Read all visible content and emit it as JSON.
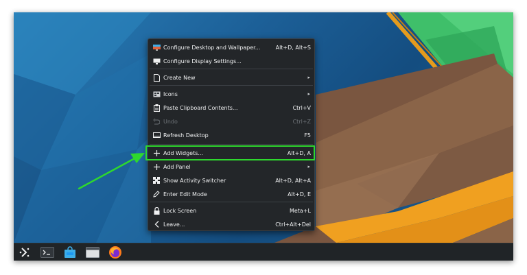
{
  "menu": {
    "items": [
      {
        "label": "Configure Desktop and Wallpaper...",
        "shortcut": "Alt+D, Alt+S",
        "icon": "configure-desktop-icon"
      },
      {
        "label": "Configure Display Settings...",
        "shortcut": "",
        "icon": "display-icon"
      },
      {
        "label": "Create New",
        "shortcut": "",
        "icon": "new-file-icon",
        "submenu": true
      },
      {
        "label": "Icons",
        "shortcut": "",
        "icon": "icons-icon",
        "submenu": true
      },
      {
        "label": "Paste Clipboard Contents...",
        "shortcut": "Ctrl+V",
        "icon": "clipboard-icon"
      },
      {
        "label": "Undo",
        "shortcut": "Ctrl+Z",
        "icon": "undo-icon",
        "disabled": true
      },
      {
        "label": "Refresh Desktop",
        "shortcut": "F5",
        "icon": "refresh-icon"
      },
      {
        "label": "Add Widgets...",
        "shortcut": "Alt+D, A",
        "icon": "plus-icon",
        "highlighted": true
      },
      {
        "label": "Add Panel",
        "shortcut": "",
        "icon": "plus-icon",
        "submenu": true
      },
      {
        "label": "Show Activity Switcher",
        "shortcut": "Alt+D, Alt+A",
        "icon": "activities-icon"
      },
      {
        "label": "Enter Edit Mode",
        "shortcut": "Alt+D, E",
        "icon": "pencil-icon"
      },
      {
        "label": "Lock Screen",
        "shortcut": "Meta+L",
        "icon": "lock-icon"
      },
      {
        "label": "Leave...",
        "shortcut": "Ctrl+Alt+Del",
        "icon": "chevron-left-icon"
      }
    ]
  },
  "taskbar": {
    "items": [
      "application-launcher-icon",
      "terminal-icon",
      "software-center-icon",
      "file-manager-icon",
      "firefox-icon"
    ]
  },
  "colors": {
    "menu_bg": "#232629",
    "highlight": "#2ed82e",
    "taskbar_bg": "#202427",
    "wallpaper_green": "#3fbf6a",
    "wallpaper_brown": "#8a6448",
    "wallpaper_orange": "#f0a020"
  }
}
